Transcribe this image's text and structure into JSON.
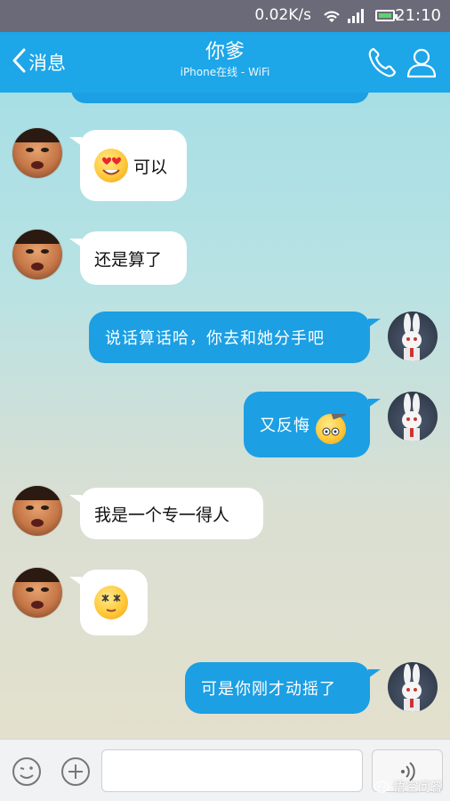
{
  "status_bar": {
    "network_rate": "0.02K/s",
    "time": "21:10",
    "battery_color": "#5fd26b"
  },
  "header": {
    "back_label": "消息",
    "title": "你爹",
    "subtitle": "iPhone在线 - WiFi",
    "background": "#1da6e8",
    "icons": [
      "back-chevron-icon",
      "phone-icon",
      "person-icon"
    ]
  },
  "messages": [
    {
      "side": "left",
      "text": "可以",
      "emoji": "heart-eyes-emoji"
    },
    {
      "side": "left",
      "text": "还是算了"
    },
    {
      "side": "right",
      "text": "说话算话哈，你去和她分手吧"
    },
    {
      "side": "right",
      "text": "又反悔",
      "emoji": "awkward-emoji"
    },
    {
      "side": "left",
      "text": "我是一个专一得人"
    },
    {
      "side": "left",
      "text": "",
      "emoji": "dizzy-emoji"
    },
    {
      "side": "right",
      "text": "可是你刚才动摇了"
    }
  ],
  "input_bar": {
    "placeholder": "",
    "icons": [
      "smiley-icon",
      "plus-icon",
      "voice-icon"
    ]
  },
  "watermark": "悟空问答",
  "colors": {
    "sent_bubble": "#1c9fe3",
    "received_bubble": "#ffffff"
  }
}
